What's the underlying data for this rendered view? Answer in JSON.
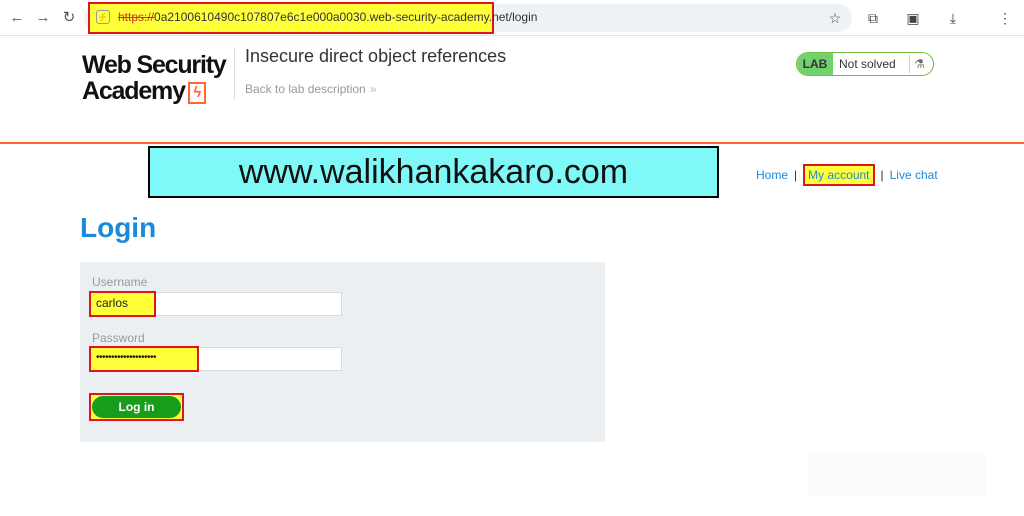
{
  "browser": {
    "url_scheme": "https://",
    "url_rest": "0a2100610490c107807e6c1e000a0030.web-security-academy.net/login",
    "icons": [
      "back-icon",
      "forward-icon",
      "reload-icon",
      "site-info-icon",
      "star-icon",
      "extensions-icon",
      "tab-search-icon",
      "download-icon",
      "menu-icon"
    ]
  },
  "header": {
    "logo_line1": "Web Security",
    "logo_line2": "Academy",
    "lab_title": "Insecure direct object references",
    "back_link": "Back to lab description",
    "lab_badge_label": "LAB",
    "lab_status": "Not solved"
  },
  "banner": {
    "text": "www.walikhankakaro.com"
  },
  "nav": {
    "home": "Home",
    "separator": "|",
    "my_account": "My account",
    "live_chat": "Live chat"
  },
  "login": {
    "title": "Login",
    "username_label": "Username",
    "username_value": "carlos",
    "password_label": "Password",
    "password_value": "••••••••••••••••••••",
    "button_label": "Log in"
  },
  "colors": {
    "accent_orange": "#ff6633",
    "link_blue": "#1a8ad9",
    "button_green": "#179c1c",
    "highlight_yellow": "#ffff3a",
    "highlight_border": "#e0141e",
    "banner_cyan": "#7ff8f8"
  }
}
